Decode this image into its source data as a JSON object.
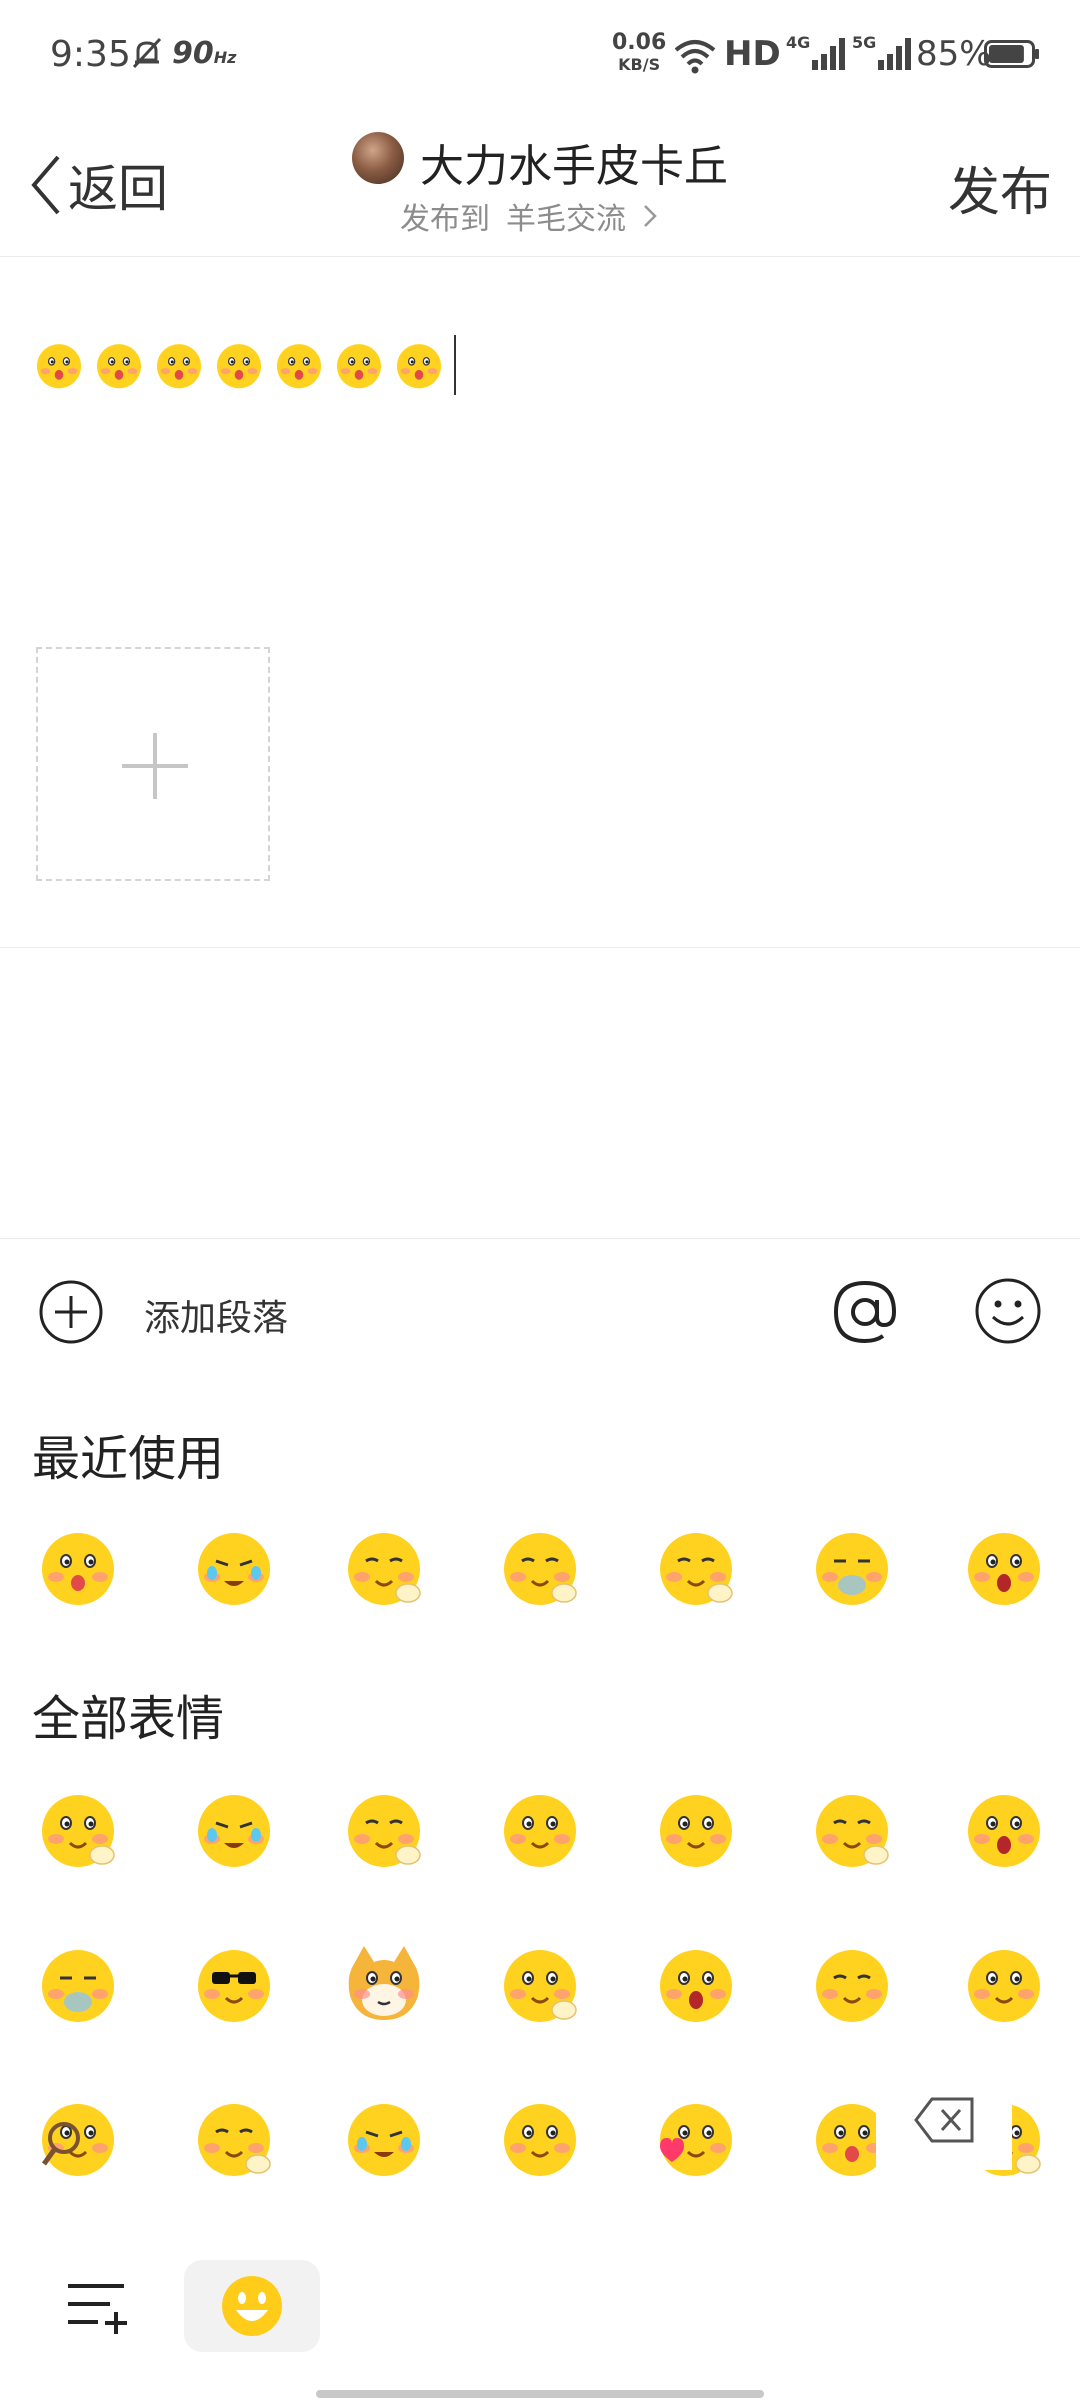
{
  "status_bar": {
    "time": "9:35",
    "refresh_rate": "90",
    "refresh_unit": "Hz",
    "net_speed_value": "0.06",
    "net_speed_unit": "KB/S",
    "hd_label": "HD",
    "net1_label": "4G",
    "net2_label": "5G",
    "battery_pct": "85%",
    "battery_level": 0.85
  },
  "header": {
    "back_label": "返回",
    "username": "大力水手皮卡丘",
    "publish_to_label": "发布到",
    "forum_name": "羊毛交流",
    "publish_label": "发布"
  },
  "editor": {
    "inline_emoji_count": 7,
    "inline_emoji_icon": "stunned-tongue-emoji"
  },
  "toolbar": {
    "add_paragraph_label": "添加段落"
  },
  "emoji_panel": {
    "recent_title": "最近使用",
    "all_title": "全部表情",
    "recent": [
      "stunned-tongue-emoji",
      "crying-laugh-emoji",
      "yawning-emoji",
      "thinking-emoji",
      "smirk-emoji",
      "sick-emoji",
      "shocked-emoji"
    ],
    "all_row1": [
      "salute-emoji",
      "wail-emoji",
      "thinking-emoji",
      "pleading-emoji",
      "watermelon-emoji",
      "smirk-emoji",
      "shocked-emoji"
    ],
    "all_row2": [
      "sick-emoji",
      "sunglasses-emoji",
      "doge-emoji",
      "ok-hand-emoji",
      "starry-eyes-emoji",
      "eyeroll-emoji",
      "angry-emoji"
    ],
    "all_row3": [
      "magnifier-emoji",
      "yawning-emoji",
      "crying-laugh-emoji",
      "cross-eyed-emoji",
      "heart-wink-emoji",
      "stunned-tongue-emoji",
      "salute-emoji"
    ]
  },
  "colors": {
    "emoji_yellow": "#ffd21f",
    "blush": "#ff8f8f",
    "divider": "#ececec"
  }
}
